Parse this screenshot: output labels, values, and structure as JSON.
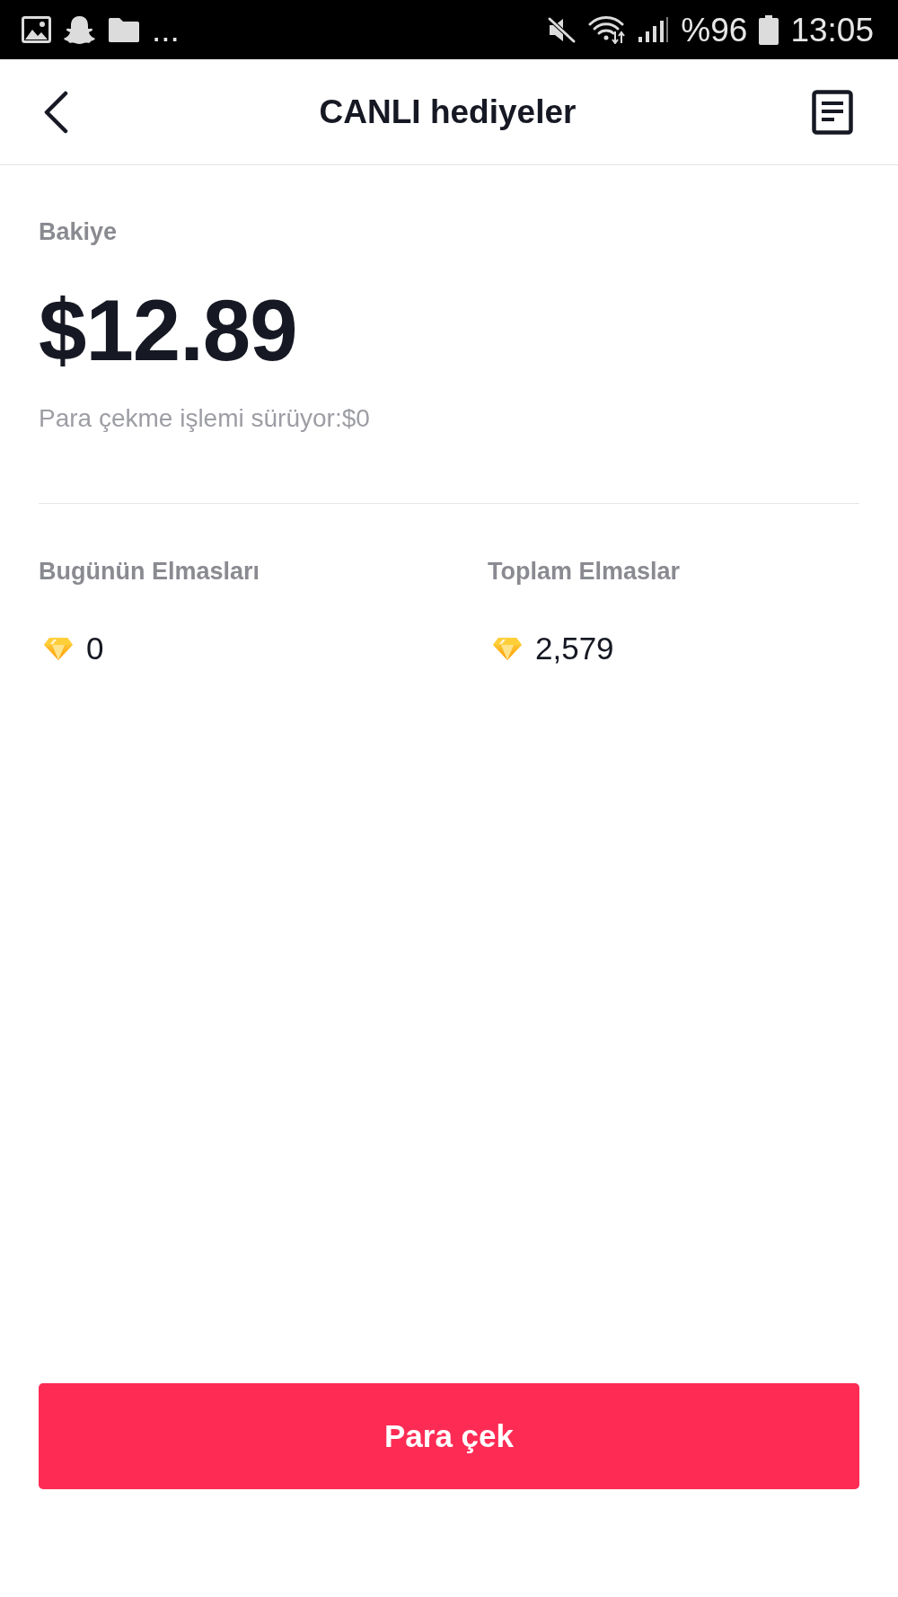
{
  "status_bar": {
    "more_notifications": "...",
    "battery_percent": "%96",
    "time": "13:05"
  },
  "header": {
    "title": "CANLI hediyeler"
  },
  "balance": {
    "label": "Bakiye",
    "amount": "$12.89",
    "pending": "Para çekme işlemi sürüyor:$0"
  },
  "diamonds": [
    {
      "label": "Bugünün Elmasları",
      "value": "0"
    },
    {
      "label": "Toplam Elmaslar",
      "value": "2,579"
    }
  ],
  "withdraw_button": {
    "label": "Para çek"
  }
}
